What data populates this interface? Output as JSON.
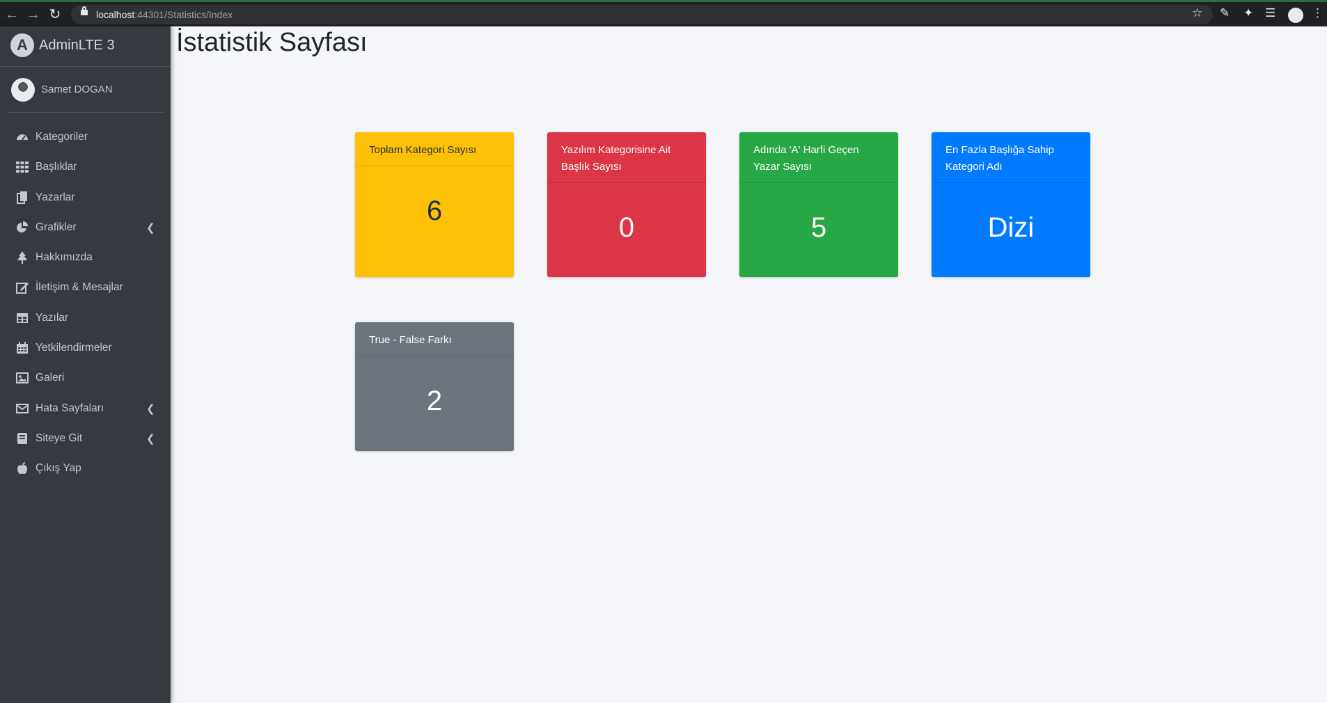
{
  "browser": {
    "url_host": "localhost",
    "url_path": ":44301/Statistics/Index"
  },
  "sidebar": {
    "brand": "AdminLTE 3",
    "user": "Samet DOGAN",
    "items": [
      {
        "label": "Kategoriler",
        "icon": "tachometer-icon"
      },
      {
        "label": "Başlıklar",
        "icon": "grid-icon"
      },
      {
        "label": "Yazarlar",
        "icon": "copy-icon"
      },
      {
        "label": "Grafikler",
        "icon": "pie-chart-icon",
        "has_chevron": true
      },
      {
        "label": "Hakkımızda",
        "icon": "tree-icon"
      },
      {
        "label": "İletişim & Mesajlar",
        "icon": "edit-icon"
      },
      {
        "label": "Yazılar",
        "icon": "table-icon"
      },
      {
        "label": "Yetkilendirmeler",
        "icon": "calendar-icon"
      },
      {
        "label": "Galeri",
        "icon": "image-icon"
      },
      {
        "label": "Hata Sayfaları",
        "icon": "envelope-icon",
        "has_chevron": true
      },
      {
        "label": "Siteye Git",
        "icon": "book-icon",
        "has_chevron": true
      },
      {
        "label": "Çıkış Yap",
        "icon": "apple-icon"
      }
    ]
  },
  "page": {
    "title": "İstatistik Sayfası"
  },
  "cards": [
    {
      "header": "Toplam Kategori Sayısı",
      "value": "6",
      "color": "#ffc107"
    },
    {
      "header": "Yazılım Kategorisine Ait Başlık Sayısı",
      "value": "0",
      "color": "#dc3545"
    },
    {
      "header": "Adında 'A' Harfi Geçen Yazar Sayısı",
      "value": "5",
      "color": "#28a745"
    },
    {
      "header": "En Fazla Başlığa Sahip Kategori Adı",
      "value": "Dizi",
      "color": "#007bff"
    },
    {
      "header": "True - False Farkı",
      "value": "2",
      "color": "#6c757d"
    }
  ]
}
